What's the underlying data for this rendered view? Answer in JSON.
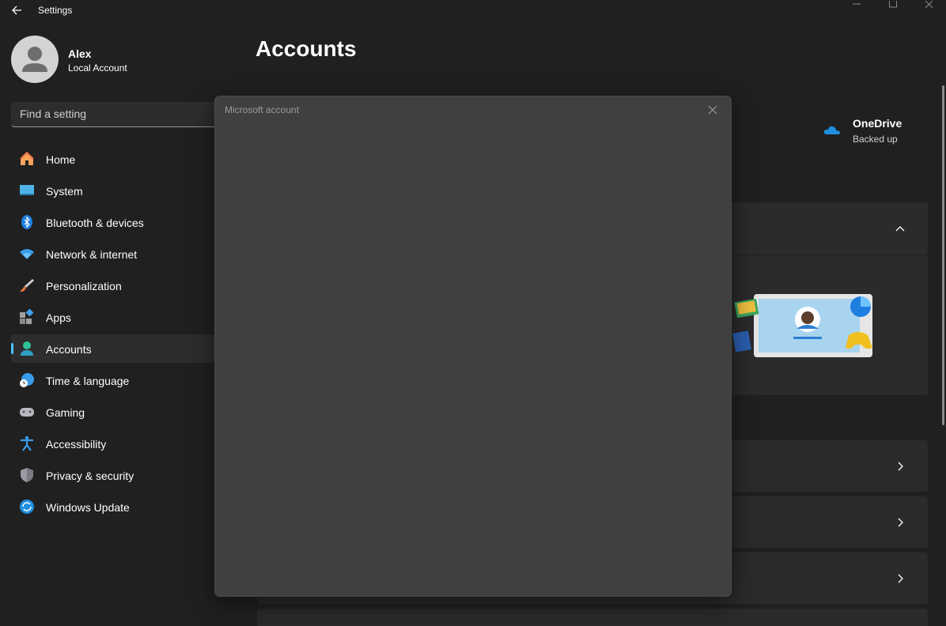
{
  "titlebar": {
    "title": "Settings"
  },
  "profile": {
    "name": "Alex",
    "account_type": "Local Account"
  },
  "search": {
    "placeholder": "Find a setting"
  },
  "nav": {
    "items": [
      {
        "label": "Home",
        "icon": "home-icon"
      },
      {
        "label": "System",
        "icon": "monitor-icon"
      },
      {
        "label": "Bluetooth & devices",
        "icon": "bluetooth-icon"
      },
      {
        "label": "Network & internet",
        "icon": "wifi-icon"
      },
      {
        "label": "Personalization",
        "icon": "paintbrush-icon"
      },
      {
        "label": "Apps",
        "icon": "apps-icon"
      },
      {
        "label": "Accounts",
        "icon": "person-icon",
        "active": true
      },
      {
        "label": "Time & language",
        "icon": "globe-clock-icon"
      },
      {
        "label": "Gaming",
        "icon": "gamepad-icon"
      },
      {
        "label": "Accessibility",
        "icon": "accessibility-icon"
      },
      {
        "label": "Privacy & security",
        "icon": "shield-icon"
      },
      {
        "label": "Windows Update",
        "icon": "update-icon"
      }
    ]
  },
  "main": {
    "title": "Accounts",
    "onedrive": {
      "name": "OneDrive",
      "status": "Backed up"
    }
  },
  "dialog": {
    "title": "Microsoft account"
  },
  "colors": {
    "accent": "#4cc2ff",
    "background": "#202020",
    "dialog": "#404040",
    "card": "#2b2b2b"
  }
}
